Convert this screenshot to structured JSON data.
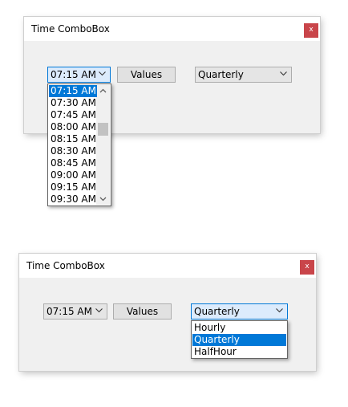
{
  "window1": {
    "title": "Time ComboBox",
    "close_label": "x",
    "time_combo_value": "07:15 AM",
    "values_button": "Values",
    "interval_combo_value": "Quarterly",
    "time_list": [
      "07:15 AM",
      "07:30 AM",
      "07:45 AM",
      "08:00 AM",
      "08:15 AM",
      "08:30 AM",
      "08:45 AM",
      "09:00 AM",
      "09:15 AM",
      "09:30 AM"
    ],
    "time_list_selected": "07:15 AM",
    "time_list_scroll_position": 0.3
  },
  "window2": {
    "title": "Time ComboBox",
    "close_label": "x",
    "time_combo_value": "07:15 AM",
    "values_button": "Values",
    "interval_combo_value": "Quarterly",
    "interval_list": [
      "Hourly",
      "Quarterly",
      "HalfHour"
    ],
    "interval_list_selected": "Quarterly"
  },
  "colors": {
    "accent": "#0078d7",
    "close_button": "#c9454a",
    "window_bg": "#f0f0f0",
    "focus_bg": "#dcebfc"
  },
  "icons": {
    "combo_arrow": "chevron-down-icon",
    "scroll_up": "chevron-up-icon",
    "scroll_down": "chevron-down-icon",
    "close": "close-icon"
  }
}
